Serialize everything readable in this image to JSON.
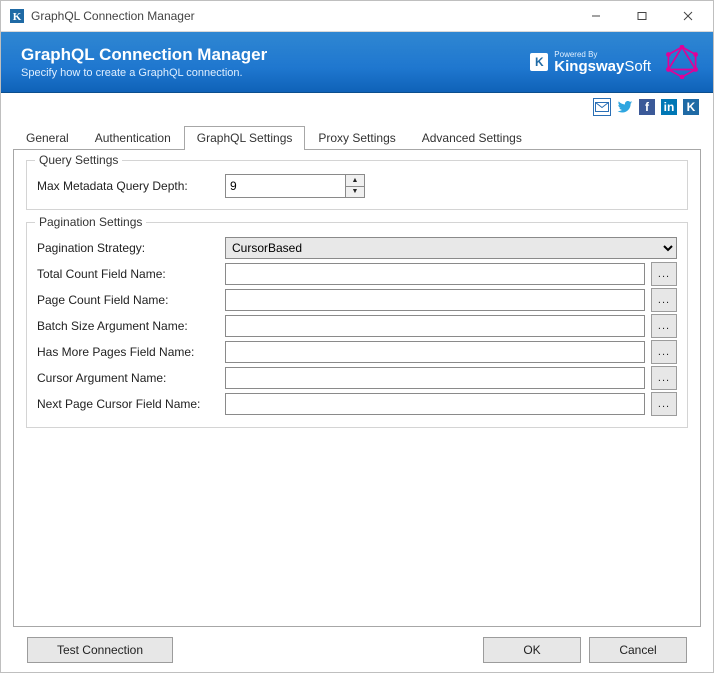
{
  "window": {
    "title": "GraphQL Connection Manager"
  },
  "banner": {
    "title": "GraphQL Connection Manager",
    "subtitle": "Specify how to create a GraphQL connection.",
    "powered_label": "Powered By",
    "brand": "KingswaySoft"
  },
  "tabs": {
    "items": [
      {
        "label": "General"
      },
      {
        "label": "Authentication"
      },
      {
        "label": "GraphQL Settings"
      },
      {
        "label": "Proxy Settings"
      },
      {
        "label": "Advanced Settings"
      }
    ],
    "active_index": 2
  },
  "query_settings": {
    "legend": "Query Settings",
    "max_depth_label": "Max Metadata Query Depth:",
    "max_depth_value": "9"
  },
  "pagination": {
    "legend": "Pagination Settings",
    "strategy_label": "Pagination Strategy:",
    "strategy_value": "CursorBased",
    "fields": [
      {
        "label": "Total Count Field Name:",
        "value": ""
      },
      {
        "label": "Page Count Field Name:",
        "value": ""
      },
      {
        "label": "Batch Size Argument Name:",
        "value": ""
      },
      {
        "label": "Has More Pages Field Name:",
        "value": ""
      },
      {
        "label": "Cursor Argument Name:",
        "value": ""
      },
      {
        "label": "Next Page Cursor Field Name:",
        "value": ""
      }
    ],
    "ellipsis": "..."
  },
  "footer": {
    "test": "Test Connection",
    "ok": "OK",
    "cancel": "Cancel"
  }
}
